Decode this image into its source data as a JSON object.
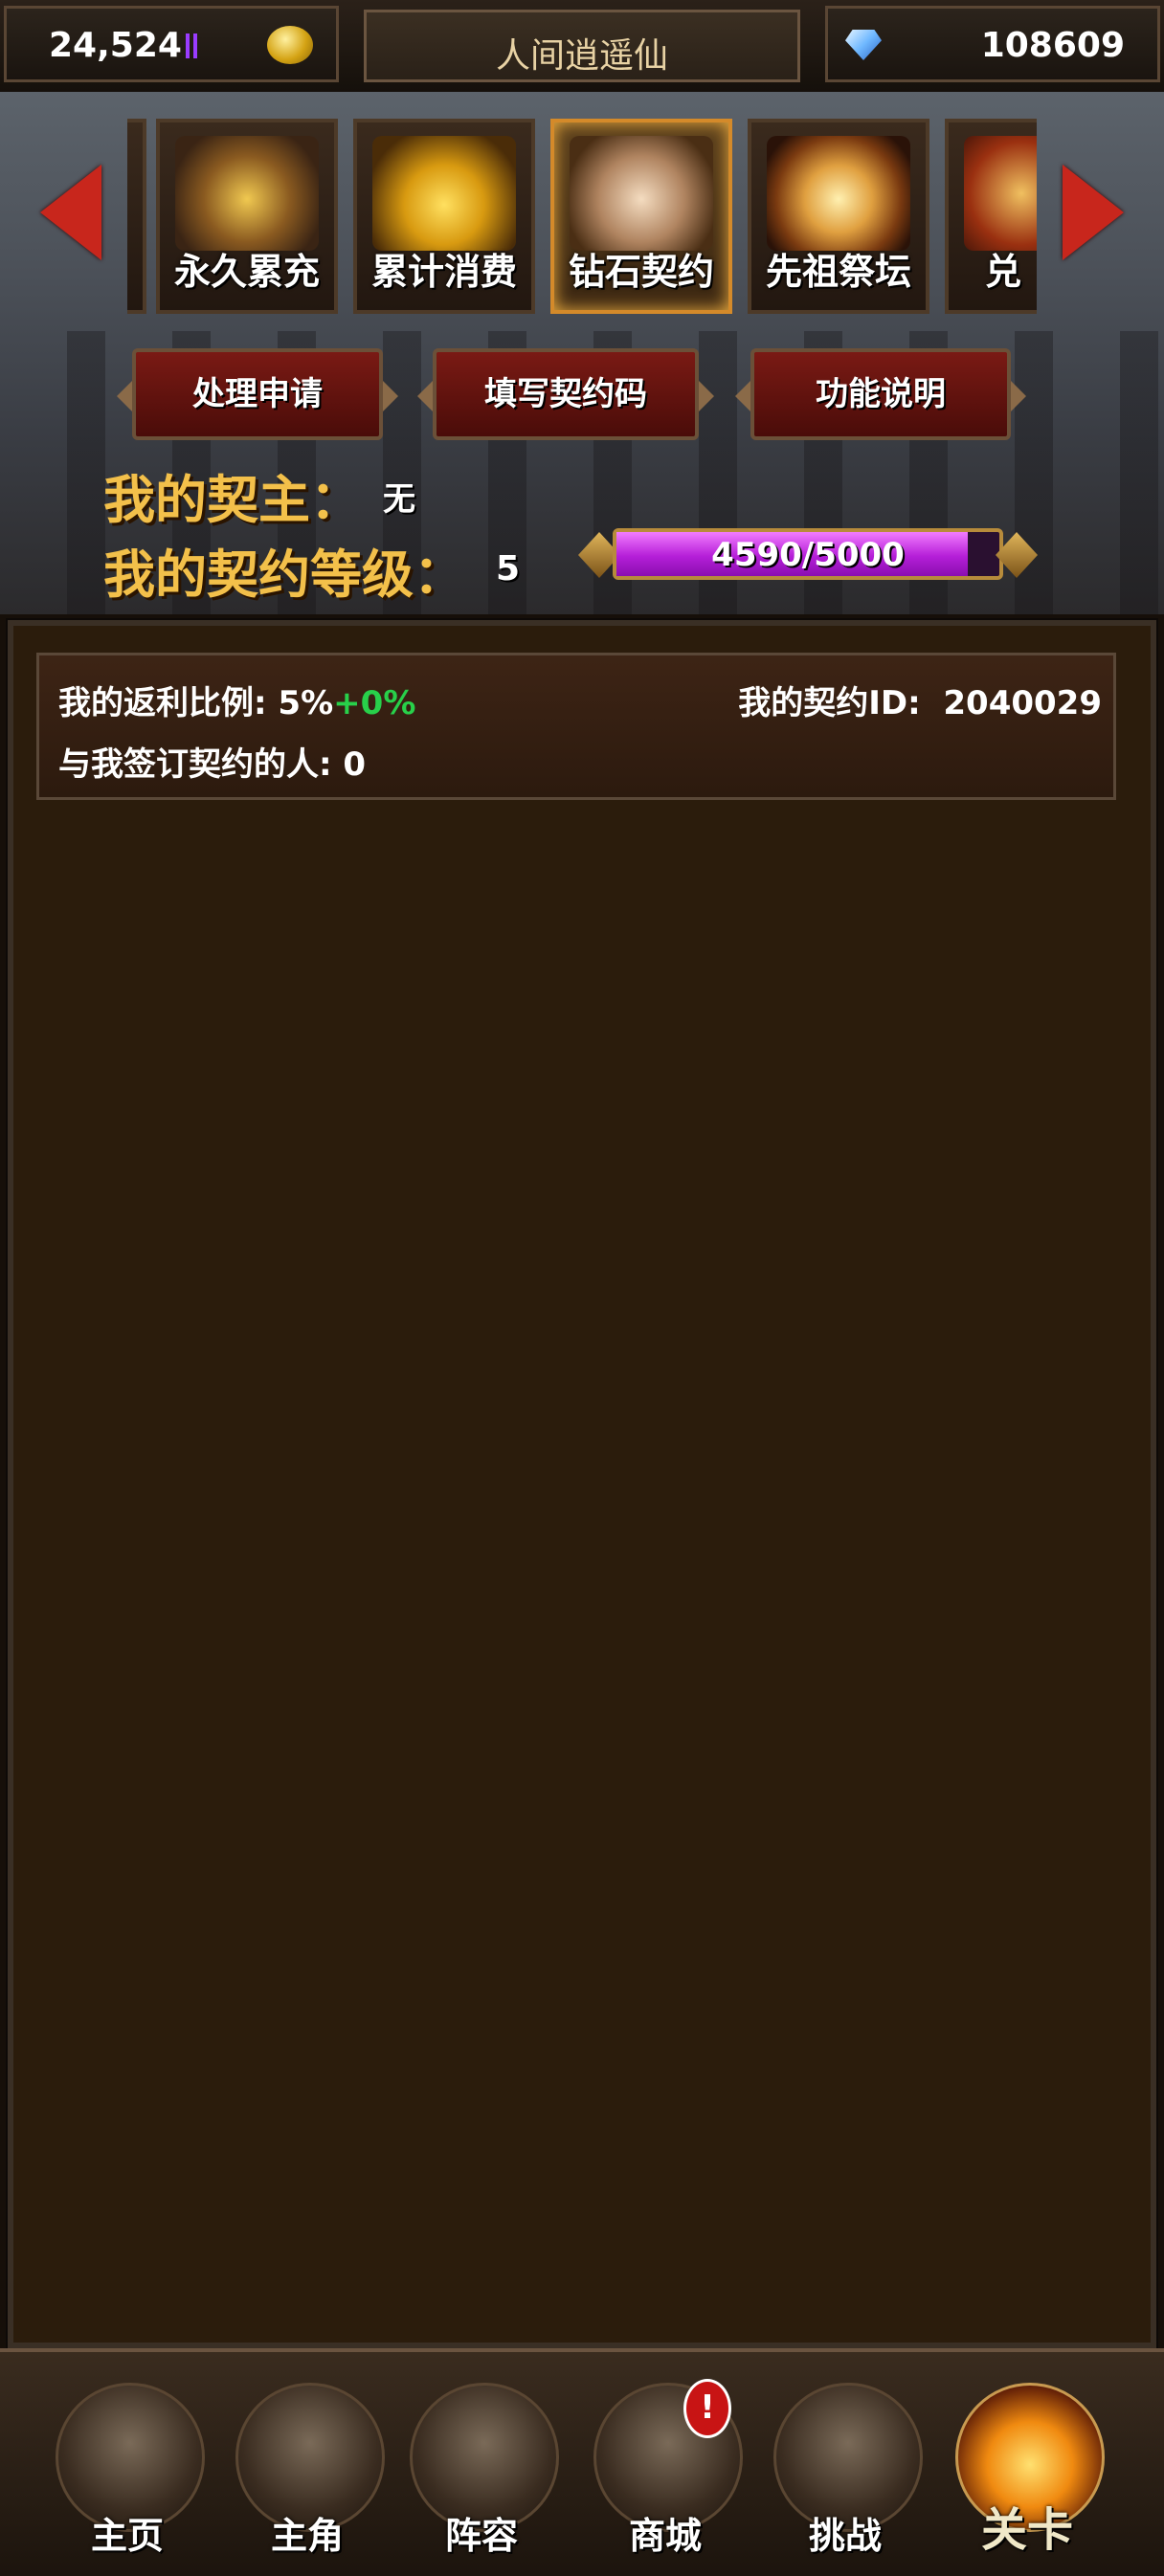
{
  "top_bar": {
    "gold": "24,524",
    "title": "人间逍遥仙",
    "gems": "108609"
  },
  "tabs": [
    {
      "label": "永久累充",
      "icon": "treasure-chest-icon",
      "active": false
    },
    {
      "label": "累计消费",
      "icon": "gold-coins-icon",
      "active": false
    },
    {
      "label": "钻石契约",
      "icon": "contract-book-icon",
      "active": true
    },
    {
      "label": "先祖祭坛",
      "icon": "altar-icon",
      "active": false
    },
    {
      "label": "兑",
      "icon": "exchange-icon",
      "active": false
    }
  ],
  "actions": {
    "process_requests": "处理申请",
    "enter_code": "填写契约码",
    "help": "功能说明"
  },
  "contract": {
    "owner_label": "我的契主：",
    "owner_value": "无",
    "level_label": "我的契约等级：",
    "level_value": "5",
    "progress_text": "4590/5000",
    "progress_fraction": 0.918
  },
  "info": {
    "rebate_label": "我的返利比例: 5%",
    "rebate_bonus": "+0%",
    "contract_id_label": "我的契约ID:",
    "contract_id": "2040029",
    "signed_label": "与我签订契约的人: 0"
  },
  "nav": [
    {
      "label": "主页",
      "icon": "castle-icon"
    },
    {
      "label": "主角",
      "icon": "hero-portrait-icon"
    },
    {
      "label": "阵容",
      "icon": "helmet-icon"
    },
    {
      "label": "商城",
      "icon": "shop-chest-icon",
      "badge": "!"
    },
    {
      "label": "挑战",
      "icon": "crossed-axes-icon"
    },
    {
      "label": "关卡",
      "icon": "flame-icon",
      "active": true
    }
  ],
  "colors": {
    "accent_gold": "#f3c04a",
    "bonus_green": "#28d04a",
    "progress_purple": "#b51fd8",
    "button_red": "#7a1a14"
  }
}
